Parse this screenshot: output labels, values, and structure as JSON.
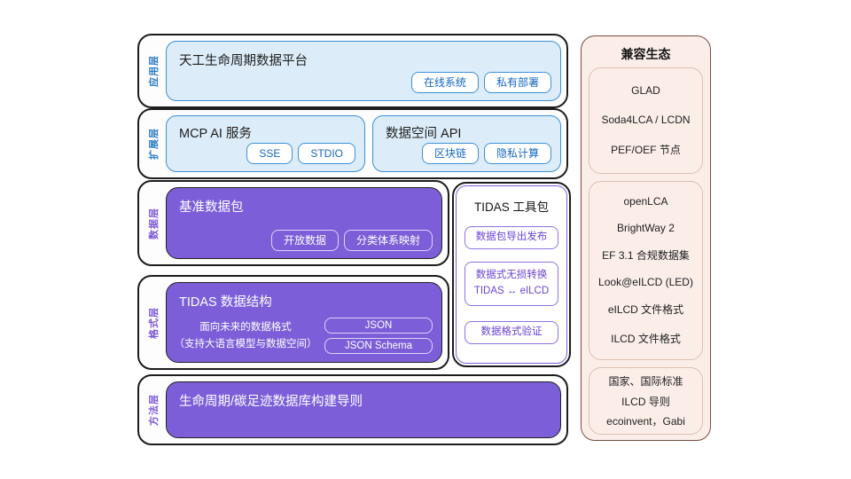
{
  "colors": {
    "blue_border": "#3c8fd8",
    "blue_fill": "#dcedf9",
    "blue_text": "#1467c0",
    "purple_fill": "#7b5ed8",
    "purple_accent": "#7e5fd9",
    "sidebar_fill": "#fbeee9",
    "sidebar_border": "#7d4a3d"
  },
  "app_layer": {
    "label": "应用层",
    "title": "天工生命周期数据平台",
    "buttons": [
      "在线系统",
      "私有部署"
    ]
  },
  "ext_layer": {
    "label": "扩展层",
    "boxes": [
      {
        "title": "MCP AI 服务",
        "buttons": [
          "SSE",
          "STDIO"
        ]
      },
      {
        "title": "数据空间 API",
        "buttons": [
          "区块链",
          "隐私计算"
        ]
      }
    ]
  },
  "data_layer": {
    "label": "数据层",
    "title": "基准数据包",
    "buttons": [
      "开放数据",
      "分类体系映射"
    ]
  },
  "format_layer": {
    "label": "格式层",
    "title": "TIDAS 数据结构",
    "desc_line1": "面向未来的数据格式",
    "desc_line2": "（支持大语言模型与数据空间）",
    "buttons": [
      "JSON",
      "JSON Schema"
    ]
  },
  "method_layer": {
    "label": "方法层",
    "title": "生命周期/碳足迹数据库构建导则"
  },
  "toolkit": {
    "title": "TIDAS 工具包",
    "items": [
      {
        "lines": [
          "数据包导出发布"
        ]
      },
      {
        "lines": [
          "数据式无损转换",
          "TIDAS  ↔  eILCD"
        ]
      },
      {
        "lines": [
          "数据格式验证"
        ]
      }
    ]
  },
  "ecosystem": {
    "title": "兼容生态",
    "groups": [
      {
        "items": [
          "GLAD",
          "Soda4LCA / LCDN",
          "PEF/OEF 节点"
        ]
      },
      {
        "items": [
          "openLCA",
          "BrightWay 2",
          "EF 3.1 合规数据集",
          "Look@eILCD (LED)",
          "eILCD 文件格式",
          "ILCD 文件格式"
        ]
      },
      {
        "items": [
          "国家、国际标准",
          "ILCD 导则",
          "ecoinvent，Gabi"
        ]
      }
    ]
  }
}
